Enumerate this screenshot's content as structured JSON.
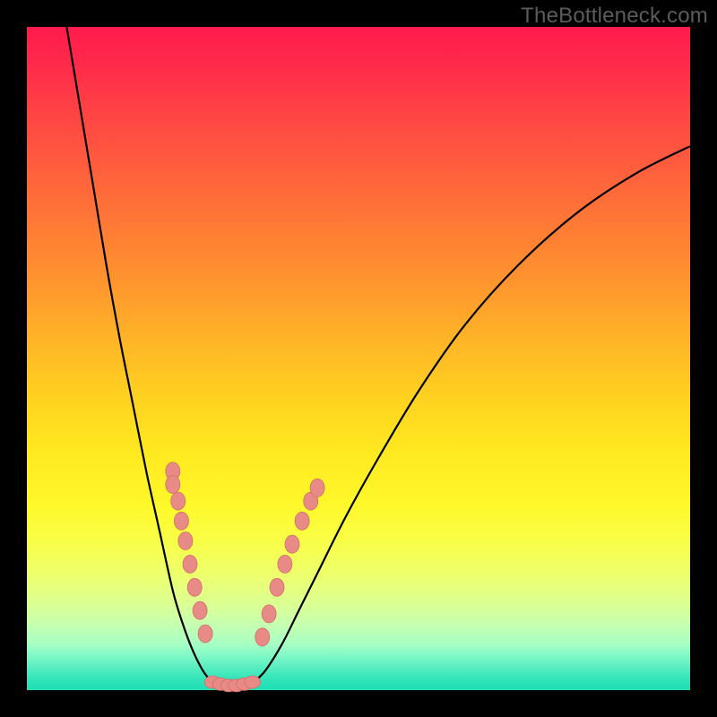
{
  "watermark": "TheBottleneck.com",
  "chart_data": {
    "type": "line",
    "title": "",
    "xlabel": "",
    "ylabel": "",
    "xlim": [
      0,
      100
    ],
    "ylim": [
      0,
      100
    ],
    "grid": false,
    "legend": false,
    "series": [
      {
        "name": "left-branch",
        "x": [
          6,
          8,
          10,
          12,
          14,
          16,
          18,
          20,
          22,
          23.5,
          25,
          26.5,
          28
        ],
        "y": [
          100,
          88,
          76,
          64,
          53,
          43,
          33,
          24,
          15,
          10,
          6,
          3,
          1
        ]
      },
      {
        "name": "valley-floor",
        "x": [
          28,
          30,
          32,
          34
        ],
        "y": [
          1,
          0.5,
          0.5,
          1
        ]
      },
      {
        "name": "right-branch",
        "x": [
          34,
          36,
          38.5,
          41,
          44,
          48,
          53,
          59,
          66,
          74,
          83,
          92,
          100
        ],
        "y": [
          1,
          3,
          7,
          12,
          18,
          26,
          35,
          45,
          55,
          64,
          72,
          78,
          82
        ]
      }
    ],
    "markers": {
      "left_branch_beads": [
        {
          "x": 22.0,
          "y": 33.0
        },
        {
          "x": 22.0,
          "y": 31.0
        },
        {
          "x": 22.8,
          "y": 28.5
        },
        {
          "x": 23.3,
          "y": 25.5
        },
        {
          "x": 23.9,
          "y": 22.5
        },
        {
          "x": 24.6,
          "y": 19.0
        },
        {
          "x": 25.3,
          "y": 15.5
        },
        {
          "x": 26.1,
          "y": 12.0
        },
        {
          "x": 26.9,
          "y": 8.5
        }
      ],
      "right_branch_beads": [
        {
          "x": 35.5,
          "y": 8.0
        },
        {
          "x": 36.5,
          "y": 11.5
        },
        {
          "x": 37.7,
          "y": 15.5
        },
        {
          "x": 38.9,
          "y": 19.0
        },
        {
          "x": 40.0,
          "y": 22.0
        },
        {
          "x": 41.5,
          "y": 25.5
        },
        {
          "x": 42.8,
          "y": 28.5
        },
        {
          "x": 43.8,
          "y": 30.5
        }
      ],
      "floor_beads": [
        {
          "x": 28.0,
          "y": 1.2
        },
        {
          "x": 29.2,
          "y": 0.9
        },
        {
          "x": 30.4,
          "y": 0.7
        },
        {
          "x": 31.6,
          "y": 0.7
        },
        {
          "x": 32.8,
          "y": 0.9
        },
        {
          "x": 34.0,
          "y": 1.2
        }
      ]
    },
    "colors": {
      "curve": "#000000",
      "beads_fill": "#e88a86",
      "beads_stroke": "#d06f6b",
      "gradient_top": "#ff1a4d",
      "gradient_mid": "#ffe920",
      "gradient_bottom": "#1fdfb4"
    }
  }
}
